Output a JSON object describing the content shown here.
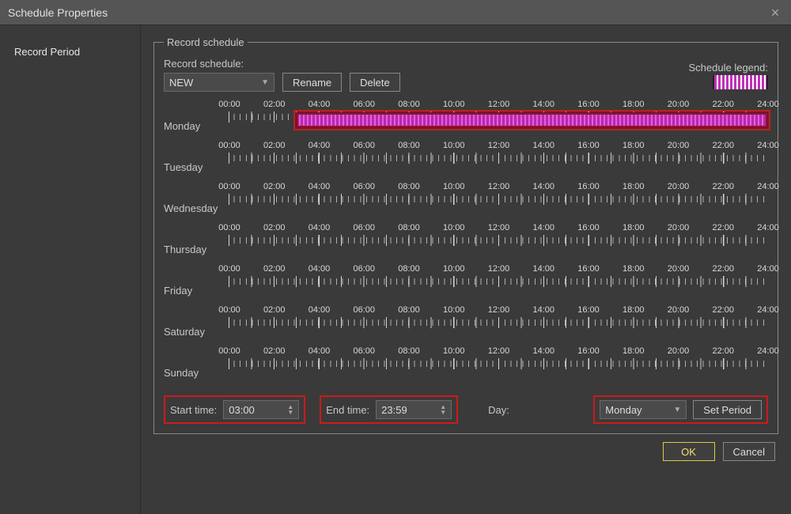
{
  "window": {
    "title": "Schedule Properties"
  },
  "sidebar": {
    "items": [
      {
        "label": "Record Period"
      }
    ]
  },
  "groupbox": {
    "legend": "Record schedule"
  },
  "top": {
    "schedule_label": "Record schedule:",
    "schedule_value": "NEW",
    "rename": "Rename",
    "delete": "Delete",
    "legend_label": "Schedule legend:"
  },
  "hours": [
    "00:00",
    "02:00",
    "04:00",
    "06:00",
    "08:00",
    "10:00",
    "12:00",
    "14:00",
    "16:00",
    "18:00",
    "20:00",
    "22:00",
    "24:00"
  ],
  "days": [
    {
      "name": "Monday",
      "periods": [
        {
          "start": "03:00",
          "end": "23:59"
        }
      ],
      "highlight": true
    },
    {
      "name": "Tuesday",
      "periods": []
    },
    {
      "name": "Wednesday",
      "periods": []
    },
    {
      "name": "Thursday",
      "periods": []
    },
    {
      "name": "Friday",
      "periods": []
    },
    {
      "name": "Saturday",
      "periods": []
    },
    {
      "name": "Sunday",
      "periods": []
    }
  ],
  "controls": {
    "start_label": "Start time:",
    "start_value": "03:00",
    "end_label": "End time:",
    "end_value": "23:59",
    "day_label": "Day:",
    "day_value": "Monday",
    "set_period": "Set Period"
  },
  "footer": {
    "ok": "OK",
    "cancel": "Cancel"
  }
}
